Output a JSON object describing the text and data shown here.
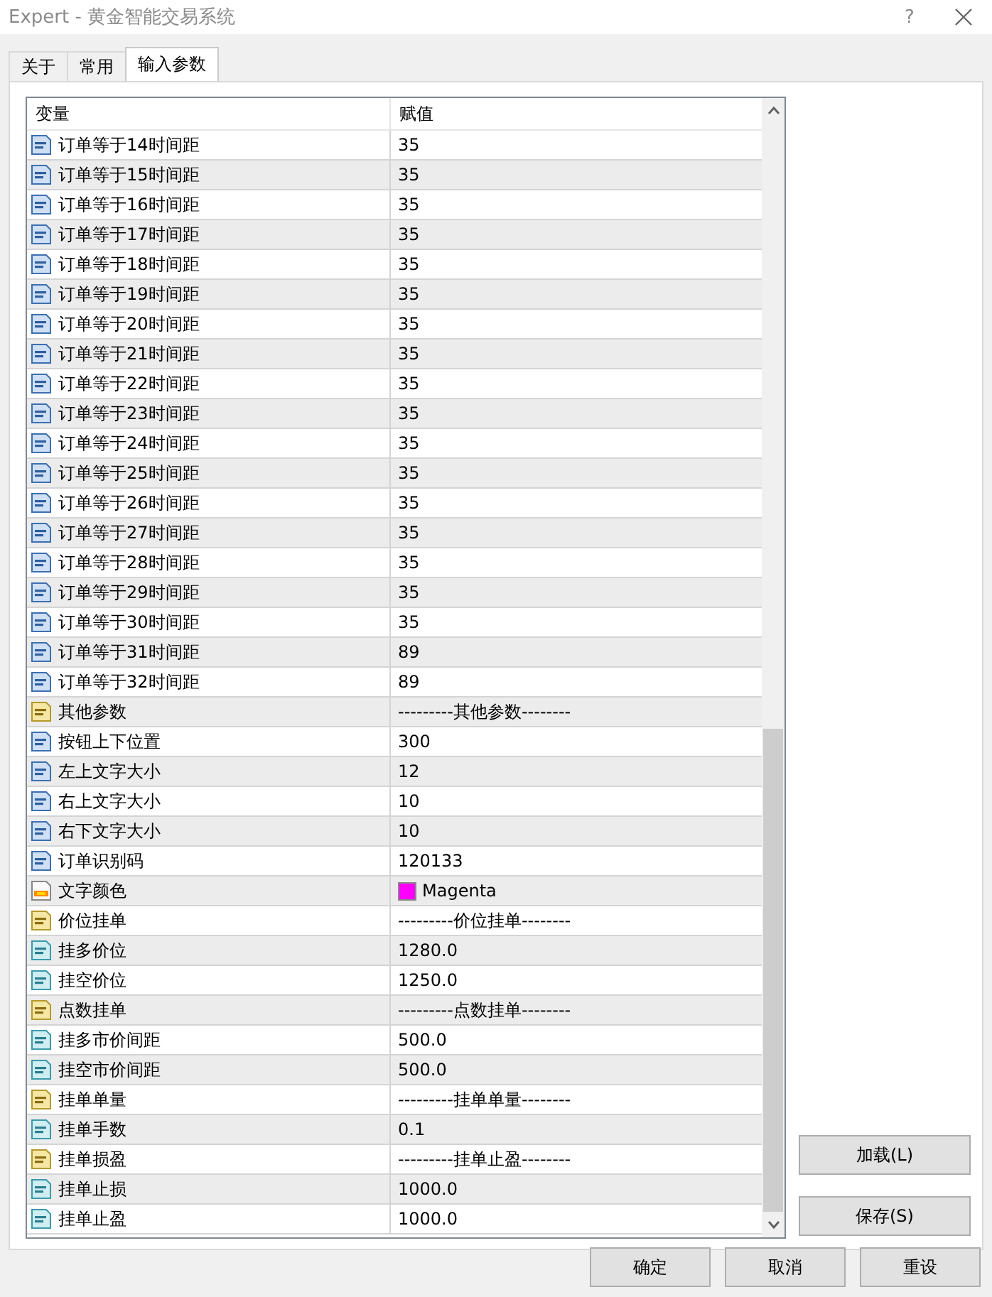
{
  "window": {
    "title": "Expert - 黄金智能交易系统",
    "help": "?"
  },
  "tabs": [
    {
      "label": "关于",
      "selected": false
    },
    {
      "label": "常用",
      "selected": false
    },
    {
      "label": "输入参数",
      "selected": true
    }
  ],
  "table": {
    "columns": [
      "变量",
      "赋值"
    ],
    "rows": [
      {
        "kind": "int",
        "name": "订单等于14时间距",
        "value": "35"
      },
      {
        "kind": "int",
        "name": "订单等于15时间距",
        "value": "35"
      },
      {
        "kind": "int",
        "name": "订单等于16时间距",
        "value": "35"
      },
      {
        "kind": "int",
        "name": "订单等于17时间距",
        "value": "35"
      },
      {
        "kind": "int",
        "name": "订单等于18时间距",
        "value": "35"
      },
      {
        "kind": "int",
        "name": "订单等于19时间距",
        "value": "35"
      },
      {
        "kind": "int",
        "name": "订单等于20时间距",
        "value": "35"
      },
      {
        "kind": "int",
        "name": "订单等于21时间距",
        "value": "35"
      },
      {
        "kind": "int",
        "name": "订单等于22时间距",
        "value": "35"
      },
      {
        "kind": "int",
        "name": "订单等于23时间距",
        "value": "35"
      },
      {
        "kind": "int",
        "name": "订单等于24时间距",
        "value": "35"
      },
      {
        "kind": "int",
        "name": "订单等于25时间距",
        "value": "35"
      },
      {
        "kind": "int",
        "name": "订单等于26时间距",
        "value": "35"
      },
      {
        "kind": "int",
        "name": "订单等于27时间距",
        "value": "35"
      },
      {
        "kind": "int",
        "name": "订单等于28时间距",
        "value": "35"
      },
      {
        "kind": "int",
        "name": "订单等于29时间距",
        "value": "35"
      },
      {
        "kind": "int",
        "name": "订单等于30时间距",
        "value": "35"
      },
      {
        "kind": "int",
        "name": "订单等于31时间距",
        "value": "89"
      },
      {
        "kind": "int",
        "name": "订单等于32时间距",
        "value": "89"
      },
      {
        "kind": "string",
        "name": "其他参数",
        "value": "---------其他参数--------"
      },
      {
        "kind": "int",
        "name": "按钮上下位置",
        "value": "300"
      },
      {
        "kind": "int",
        "name": "左上文字大小",
        "value": "12"
      },
      {
        "kind": "int",
        "name": "右上文字大小",
        "value": "10"
      },
      {
        "kind": "int",
        "name": "右下文字大小",
        "value": "10"
      },
      {
        "kind": "int",
        "name": "订单识别码",
        "value": "120133"
      },
      {
        "kind": "color",
        "name": "文字颜色",
        "value": "Magenta",
        "color": "#ff00ff"
      },
      {
        "kind": "string",
        "name": "价位挂单",
        "value": "---------价位挂单--------"
      },
      {
        "kind": "double",
        "name": "挂多价位",
        "value": "1280.0"
      },
      {
        "kind": "double",
        "name": "挂空价位",
        "value": "1250.0"
      },
      {
        "kind": "string",
        "name": "点数挂单",
        "value": "---------点数挂单--------"
      },
      {
        "kind": "double",
        "name": "挂多市价间距",
        "value": "500.0"
      },
      {
        "kind": "double",
        "name": "挂空市价间距",
        "value": "500.0"
      },
      {
        "kind": "string",
        "name": "挂单单量",
        "value": "---------挂单单量--------"
      },
      {
        "kind": "double",
        "name": "挂单手数",
        "value": "0.1"
      },
      {
        "kind": "string",
        "name": "挂单损盈",
        "value": "---------挂单止盈--------"
      },
      {
        "kind": "double",
        "name": "挂单止损",
        "value": "1000.0"
      },
      {
        "kind": "double",
        "name": "挂单止盈",
        "value": "1000.0"
      }
    ]
  },
  "side_buttons": [
    "加载(L)",
    "保存(S)"
  ],
  "buttons": [
    "确定",
    "取消",
    "重设"
  ]
}
